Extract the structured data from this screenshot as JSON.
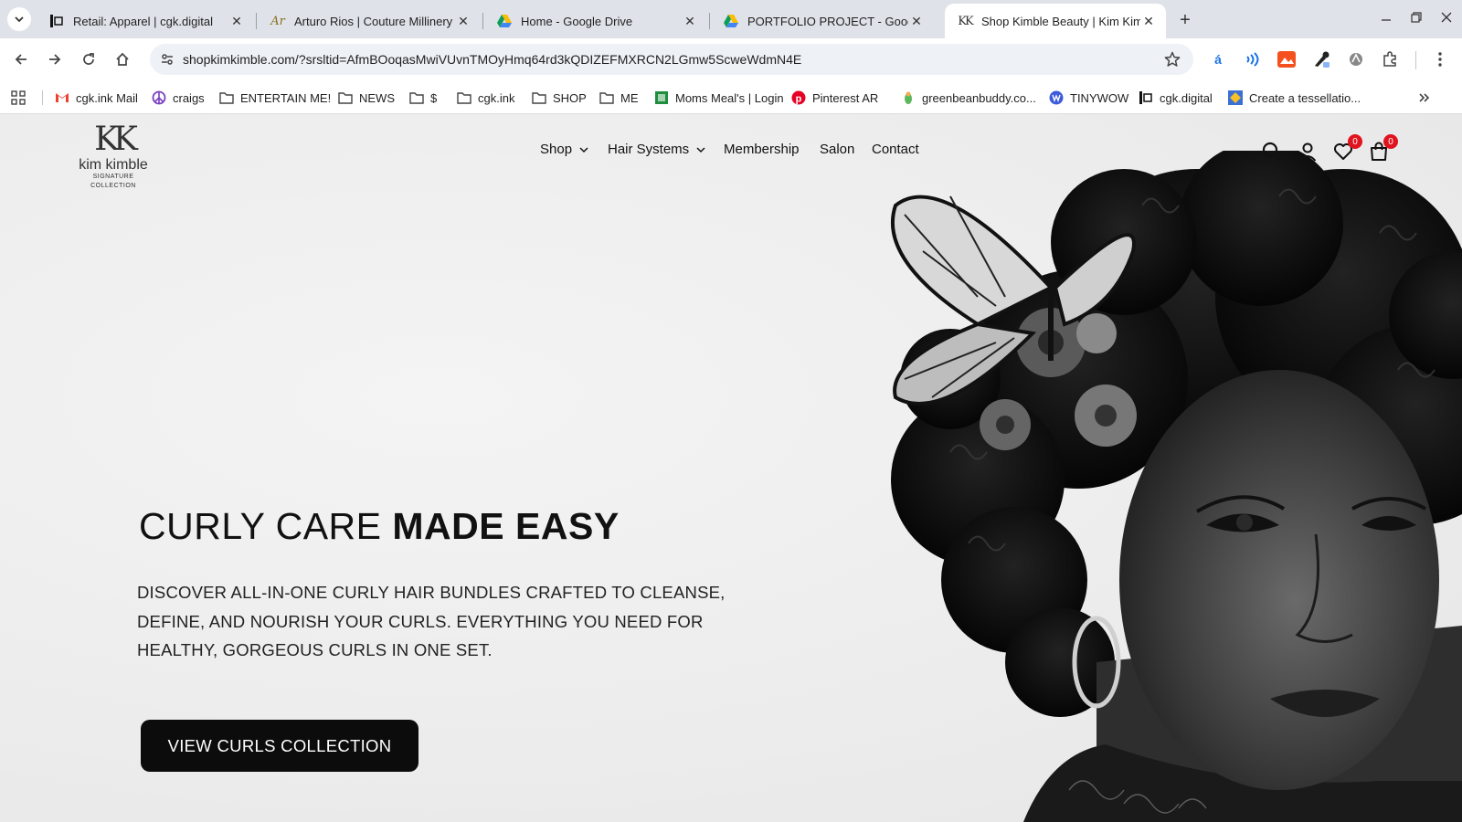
{
  "browser": {
    "tabs": [
      {
        "title": "Retail: Apparel | cgk.digital",
        "favicon": "cgk-icon",
        "active": false
      },
      {
        "title": "Arturo Rios | Couture Millinery",
        "favicon": "ar-script-icon",
        "active": false
      },
      {
        "title": "Home - Google Drive",
        "favicon": "google-drive-icon",
        "active": false
      },
      {
        "title": "PORTFOLIO PROJECT - Google",
        "favicon": "google-drive-icon",
        "active": false
      },
      {
        "title": "Shop Kimble Beauty | Kim Kimb",
        "favicon": "kk-logo-icon",
        "active": true
      }
    ],
    "url": "shopkimkimble.com/?srsltid=AfmBOoqasMwiVUvnTMOyHmq64rd3kQDIZEFMXRCN2LGmw5ScweWdmN4E",
    "bookmarks": [
      {
        "label": "cgk.ink Mail",
        "icon": "gmail-icon"
      },
      {
        "label": "craigs",
        "icon": "peace-icon"
      },
      {
        "label": "ENTERTAIN ME!",
        "icon": "folder-icon"
      },
      {
        "label": "NEWS",
        "icon": "folder-icon"
      },
      {
        "label": "$",
        "icon": "folder-icon"
      },
      {
        "label": "cgk.ink",
        "icon": "folder-icon"
      },
      {
        "label": "SHOP",
        "icon": "folder-icon"
      },
      {
        "label": "ME",
        "icon": "folder-icon"
      },
      {
        "label": "Moms Meal's | Login",
        "icon": "moms-meals-icon"
      },
      {
        "label": "Pinterest AR",
        "icon": "pinterest-icon"
      },
      {
        "label": "greenbeanbuddy.co...",
        "icon": "greenbean-icon"
      },
      {
        "label": "TINYWOW",
        "icon": "tinywow-icon"
      },
      {
        "label": "cgk.digital",
        "icon": "cgk-icon"
      },
      {
        "label": "Create a tessellatio...",
        "icon": "tessellation-icon"
      }
    ]
  },
  "site": {
    "logo": {
      "mark": "KK",
      "name": "kim kimble",
      "sub": "SIGNATURE COLLECTION"
    },
    "nav": [
      {
        "label": "Shop",
        "dropdown": true
      },
      {
        "label": "Hair Systems",
        "dropdown": true
      },
      {
        "label": "Membership",
        "dropdown": false
      },
      {
        "label": "Salon",
        "dropdown": false
      },
      {
        "label": "Contact",
        "dropdown": false
      }
    ],
    "wishlist_count": "0",
    "cart_count": "0",
    "hero": {
      "title_regular": "CURLY CARE",
      "title_bold": "MADE EASY",
      "text": "DISCOVER ALL-IN-ONE CURLY HAIR BUNDLES CRAFTED TO CLEANSE, DEFINE, AND NOURISH YOUR CURLS. EVERYTHING YOU NEED FOR HEALTHY, GORGEOUS CURLS IN ONE SET.",
      "cta": "VIEW CURLS COLLECTION"
    },
    "colors": {
      "badge": "#e0141e",
      "cta_bg": "#0c0c0c",
      "text": "#111111"
    }
  }
}
